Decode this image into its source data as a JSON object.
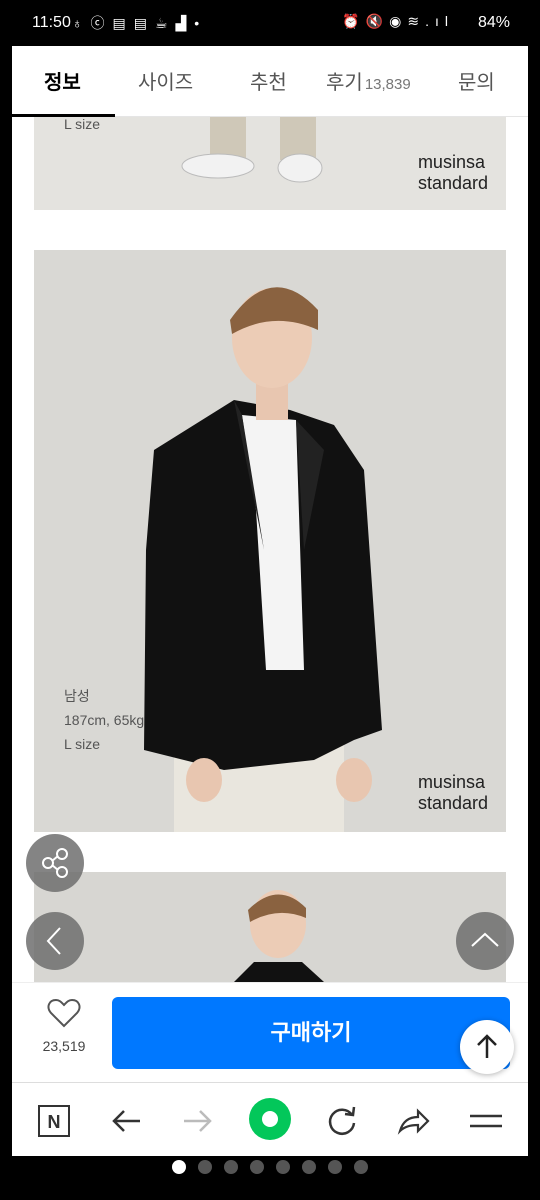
{
  "status_bar": {
    "time": "11:50",
    "battery": "84%",
    "icons_left": [
      "notification-icon",
      "c-app-icon",
      "news-icon",
      "news-icon",
      "coffee-icon",
      "signal-icon",
      "dot-icon"
    ],
    "icons_right": [
      "alarm-icon",
      "mute-icon",
      "location-icon",
      "wifi-icon",
      "signal-icon",
      "battery-icon"
    ]
  },
  "tabs": [
    {
      "label": "정보",
      "active": true
    },
    {
      "label": "사이즈"
    },
    {
      "label": "추천"
    },
    {
      "label": "후기",
      "count": "13,839"
    },
    {
      "label": "문의"
    }
  ],
  "photos": [
    {
      "caption_lines": [
        "L size"
      ],
      "brand_lines": [
        "musinsa",
        "standard"
      ]
    },
    {
      "caption_lines": [
        "남성",
        "187cm, 65kg",
        "L size"
      ],
      "brand_lines": [
        "musinsa",
        "standard"
      ]
    }
  ],
  "bottom_bar": {
    "like_count": "23,519",
    "buy_label": "구매하기"
  },
  "browser_nav": [
    "naver-icon",
    "back-arrow-icon",
    "forward-arrow-icon",
    "home-dot-icon",
    "refresh-icon",
    "share-arrow-icon",
    "menu-icon"
  ],
  "pager": {
    "count": 8,
    "active_index": 0
  }
}
